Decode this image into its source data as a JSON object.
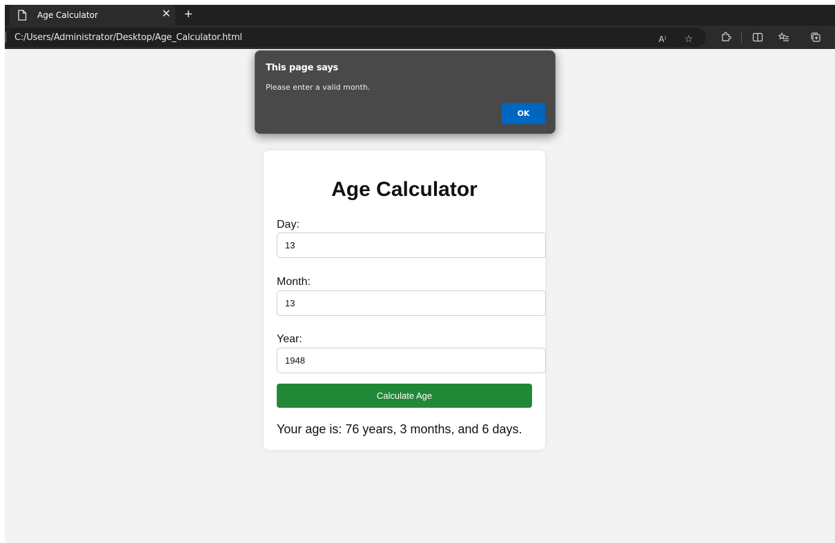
{
  "browser": {
    "tab": {
      "title": "Age Calculator",
      "close_glyph": "✕",
      "icon": "page-icon"
    },
    "new_tab_glyph": "+",
    "address_bar": {
      "url": "C:/Users/Administrator/Desktop/Age_Calculator.html"
    },
    "toolbar_icons": {
      "read_aloud": "A⁾",
      "favorite": "☆",
      "extensions": "⚙",
      "split_screen": "◫",
      "favorites_list": "☰",
      "collections": "⊕"
    },
    "colors": {
      "tabstrip": "#202020",
      "toolbar": "#2b2b2b"
    }
  },
  "alert": {
    "title": "This page says",
    "message": "Please enter a valid month.",
    "ok_label": "OK",
    "ok_color": "#0067c0"
  },
  "card": {
    "title": "Age Calculator",
    "fields": [
      {
        "label": "Day:",
        "value": "13"
      },
      {
        "label": "Month:",
        "value": "13"
      },
      {
        "label": "Year:",
        "value": "1948"
      }
    ],
    "button_label": "Calculate Age",
    "button_color": "#218838",
    "result": "Your age is: 76 years, 3 months, and 6 days."
  }
}
